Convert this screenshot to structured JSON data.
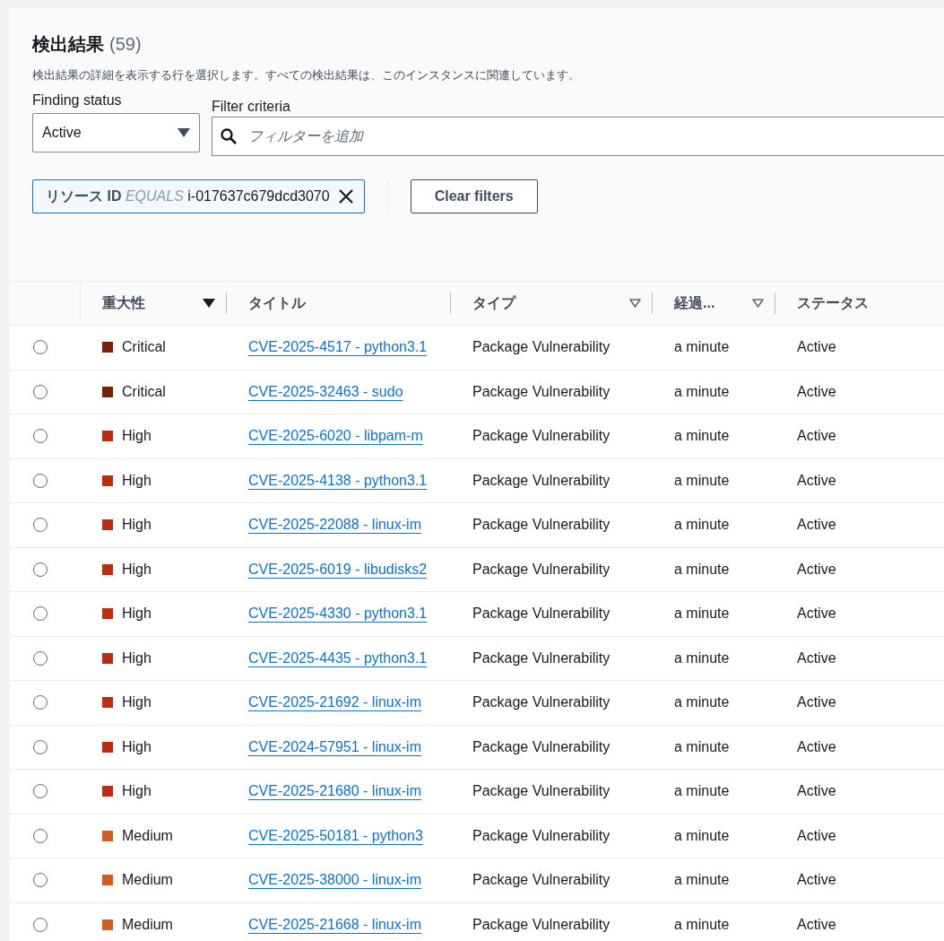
{
  "header": {
    "title": "検出結果",
    "count": "(59)",
    "description": "検出結果の詳細を表示する行を選択します。すべての検出結果は、このインスタンスに関連しています。"
  },
  "filters": {
    "status_label": "Finding status",
    "status_value": "Active",
    "criteria_label": "Filter criteria",
    "criteria_placeholder": "フィルターを追加",
    "token": {
      "key": "リソース ID",
      "operator": "EQUALS",
      "value": "i-017637c679dcd3070"
    },
    "clear_button": "Clear filters"
  },
  "table": {
    "columns": [
      {
        "label": "重大性",
        "sorted": true
      },
      {
        "label": "タイトル"
      },
      {
        "label": "タイプ",
        "sorted": false
      },
      {
        "label": "経過...",
        "sorted": false
      },
      {
        "label": "ステータス"
      }
    ],
    "rows": [
      {
        "selected": false,
        "severity": "Critical",
        "color": "#7d2105",
        "title": "CVE-2025-4517 - python3.1",
        "type": "Package Vulnerability",
        "age": "a minute",
        "status": "Active"
      },
      {
        "selected": false,
        "severity": "Critical",
        "color": "#7d2105",
        "title": "CVE-2025-32463 - sudo",
        "type": "Package Vulnerability",
        "age": "a minute",
        "status": "Active"
      },
      {
        "selected": false,
        "severity": "High",
        "color": "#ba2e0f",
        "title": "CVE-2025-6020 - libpam-m",
        "type": "Package Vulnerability",
        "age": "a minute",
        "status": "Active"
      },
      {
        "selected": false,
        "severity": "High",
        "color": "#ba2e0f",
        "title": "CVE-2025-4138 - python3.1",
        "type": "Package Vulnerability",
        "age": "a minute",
        "status": "Active"
      },
      {
        "selected": false,
        "severity": "High",
        "color": "#ba2e0f",
        "title": "CVE-2025-22088 - linux-im",
        "type": "Package Vulnerability",
        "age": "a minute",
        "status": "Active"
      },
      {
        "selected": false,
        "severity": "High",
        "color": "#ba2e0f",
        "title": "CVE-2025-6019 - libudisks2",
        "type": "Package Vulnerability",
        "age": "a minute",
        "status": "Active"
      },
      {
        "selected": false,
        "severity": "High",
        "color": "#ba2e0f",
        "title": "CVE-2025-4330 - python3.1",
        "type": "Package Vulnerability",
        "age": "a minute",
        "status": "Active"
      },
      {
        "selected": false,
        "severity": "High",
        "color": "#ba2e0f",
        "title": "CVE-2025-4435 - python3.1",
        "type": "Package Vulnerability",
        "age": "a minute",
        "status": "Active"
      },
      {
        "selected": false,
        "severity": "High",
        "color": "#ba2e0f",
        "title": "CVE-2025-21692 - linux-im",
        "type": "Package Vulnerability",
        "age": "a minute",
        "status": "Active"
      },
      {
        "selected": false,
        "severity": "High",
        "color": "#ba2e0f",
        "title": "CVE-2024-57951 - linux-im",
        "type": "Package Vulnerability",
        "age": "a minute",
        "status": "Active"
      },
      {
        "selected": false,
        "severity": "High",
        "color": "#ba2e0f",
        "title": "CVE-2025-21680 - linux-im",
        "type": "Package Vulnerability",
        "age": "a minute",
        "status": "Active"
      },
      {
        "selected": false,
        "severity": "Medium",
        "color": "#cc5f21",
        "title": "CVE-2025-50181 - python3",
        "type": "Package Vulnerability",
        "age": "a minute",
        "status": "Active"
      },
      {
        "selected": false,
        "severity": "Medium",
        "color": "#cc5f21",
        "title": "CVE-2025-38000 - linux-im",
        "type": "Package Vulnerability",
        "age": "a minute",
        "status": "Active"
      },
      {
        "selected": false,
        "severity": "Medium",
        "color": "#cc5f21",
        "title": "CVE-2025-21668 - linux-im",
        "type": "Package Vulnerability",
        "age": "a minute",
        "status": "Active"
      }
    ]
  }
}
